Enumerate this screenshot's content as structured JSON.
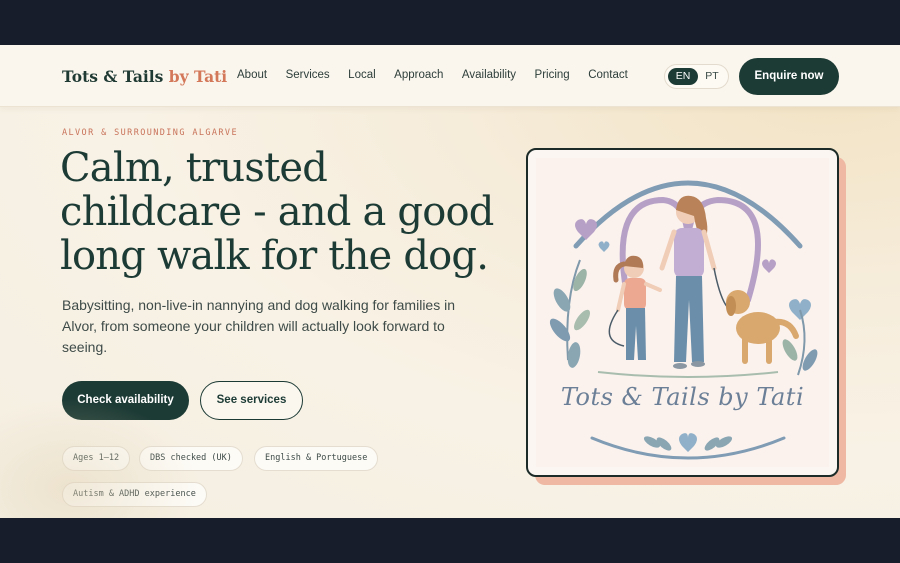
{
  "brand": {
    "name": "Tots & Tails",
    "by": "by Tati"
  },
  "nav": [
    "About",
    "Services",
    "Local",
    "Approach",
    "Availability",
    "Pricing",
    "Contact"
  ],
  "language": {
    "options": [
      "EN",
      "PT"
    ],
    "selected": "EN"
  },
  "header_cta": "Enquire now",
  "hero": {
    "eyebrow": "ALVOR & SURROUNDING ALGARVE",
    "headline": "Calm, trusted childcare - and a good long walk for the dog.",
    "lede": "Babysitting, non-live-in nannying and dog walking for families in Alvor, from someone your children will actually look forward to seeing.",
    "primary_button": "Check availability",
    "secondary_button": "See services",
    "chips": [
      "Ages 1–12",
      "DBS checked (UK)",
      "English & Portuguese",
      "Autism & ADHD experience"
    ]
  },
  "illustration": {
    "caption": "Tots & Tails by Tati"
  },
  "colors": {
    "primary": "#1d3b35",
    "accent": "#d4785a",
    "card_shadow": "#eeb8a3",
    "page_bg": "#f6eedf",
    "frame_bg": "#171d2b"
  }
}
